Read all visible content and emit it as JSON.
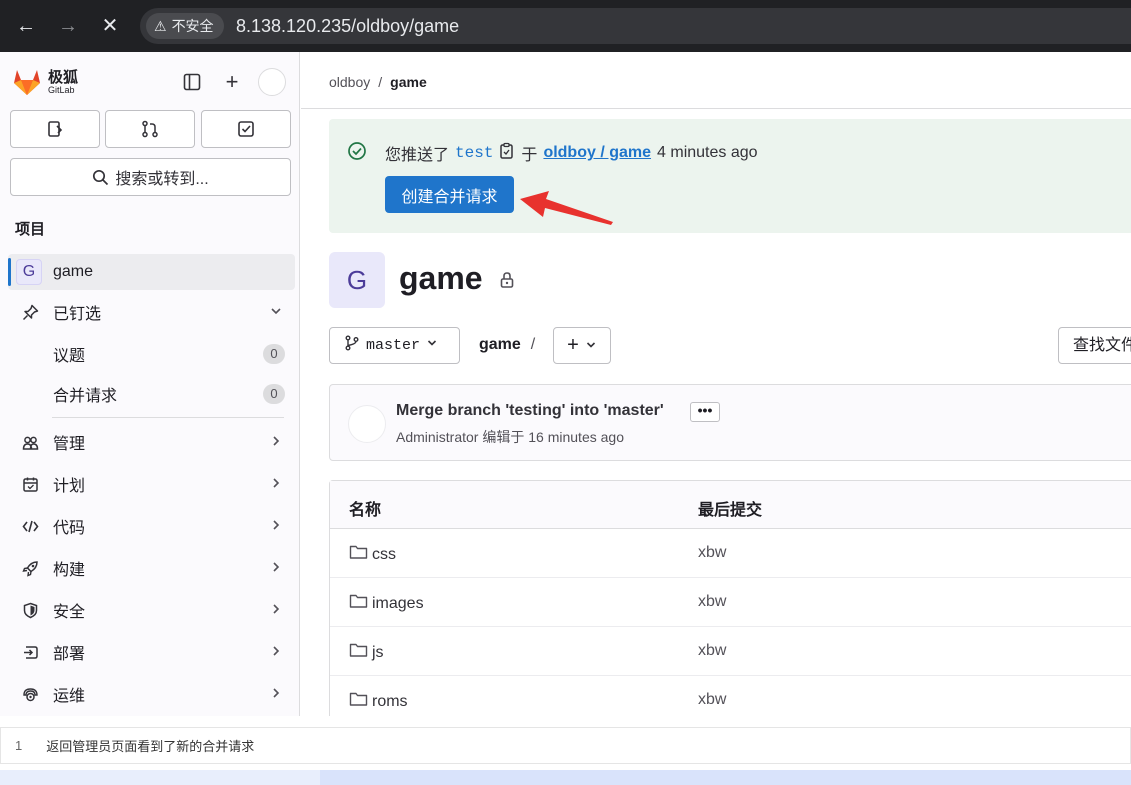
{
  "browser": {
    "security_label": "不安全",
    "url": "8.138.120.235/oldboy/game"
  },
  "sidebar": {
    "logo_cn": "极狐",
    "logo_en": "GitLab",
    "search_label": "搜索或转到...",
    "section_label": "项目",
    "project": {
      "avatar_letter": "G",
      "name": "game"
    },
    "pinned": {
      "label": "已钉选",
      "items": [
        {
          "label": "议题",
          "count": "0"
        },
        {
          "label": "合并请求",
          "count": "0"
        }
      ]
    },
    "nav": [
      {
        "label": "管理",
        "icon": "users-icon"
      },
      {
        "label": "计划",
        "icon": "calendar-icon"
      },
      {
        "label": "代码",
        "icon": "code-icon"
      },
      {
        "label": "构建",
        "icon": "rocket-icon"
      },
      {
        "label": "安全",
        "icon": "shield-icon"
      },
      {
        "label": "部署",
        "icon": "deploy-icon"
      },
      {
        "label": "运维",
        "icon": "monitor-icon"
      }
    ]
  },
  "main": {
    "breadcrumb": {
      "group": "oldboy",
      "separator": "/",
      "project": "game"
    },
    "alert": {
      "prefix": "您推送了",
      "branch": "test",
      "middle": "于",
      "project_link": "oldboy / game",
      "time": "4 minutes ago",
      "button_label": "创建合并请求"
    },
    "project": {
      "avatar_letter": "G",
      "title": "game"
    },
    "toolbar": {
      "branch": "master",
      "path_project": "game",
      "path_sep": "/",
      "add_label": "+",
      "find_file_label": "查找文件"
    },
    "commit": {
      "title": "Merge branch 'testing' into 'master'",
      "ellipsis": "•••",
      "author": "Administrator",
      "meta": "编辑于 16 minutes ago"
    },
    "table": {
      "headers": [
        "名称",
        "最后提交"
      ],
      "rows": [
        {
          "name": "css",
          "commit": "xbw"
        },
        {
          "name": "images",
          "commit": "xbw"
        },
        {
          "name": "js",
          "commit": "xbw"
        },
        {
          "name": "roms",
          "commit": "xbw"
        }
      ]
    }
  },
  "caption": {
    "number": "1",
    "text": "返回管理员页面看到了新的合并请求"
  },
  "colors": {
    "accent": "#1f75cb",
    "alert_bg": "#ecf4ee",
    "success": "#217645",
    "annotation_arrow": "#e8322e",
    "browser_chrome": "#202124"
  }
}
